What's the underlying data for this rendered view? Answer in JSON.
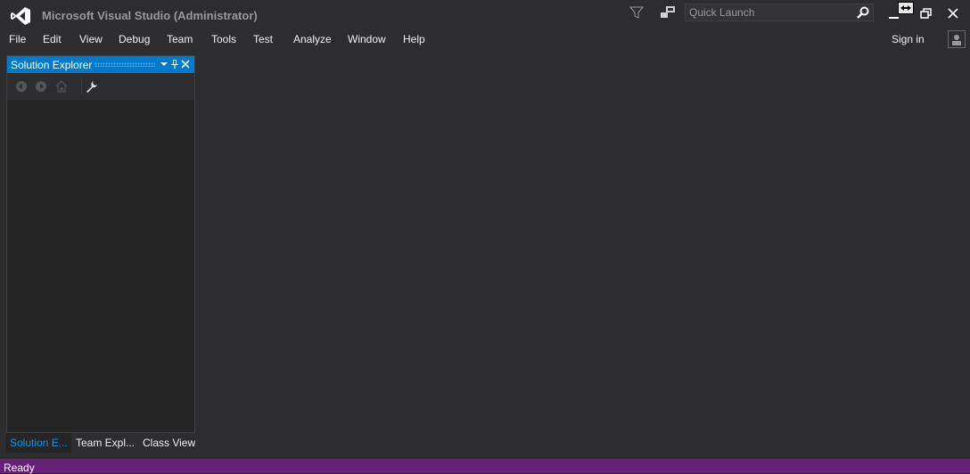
{
  "window": {
    "title": "Microsoft Visual Studio (Administrator)"
  },
  "search": {
    "placeholder": "Quick Launch"
  },
  "menu": {
    "items": [
      {
        "label": "File"
      },
      {
        "label": "Edit"
      },
      {
        "label": "View"
      },
      {
        "label": "Debug"
      },
      {
        "label": "Team"
      },
      {
        "label": "Tools"
      },
      {
        "label": "Test"
      },
      {
        "label": "Analyze"
      },
      {
        "label": "Window"
      },
      {
        "label": "Help"
      }
    ]
  },
  "account": {
    "signin_label": "Sign in"
  },
  "solution_explorer": {
    "title": "Solution Explorer",
    "icons": [
      "back-icon",
      "forward-icon",
      "home-icon",
      "wrench-icon"
    ]
  },
  "bottom_tabs": [
    {
      "label": "Solution E..."
    },
    {
      "label": "Team Expl..."
    },
    {
      "label": "Class View"
    }
  ],
  "status": {
    "text": "Ready"
  },
  "colors": {
    "background": "#2d2d30",
    "accent": "#007acc",
    "statusbar": "#68217a",
    "panel": "#252526",
    "active_tab_text": "#0e97e8",
    "logo": "#ffffff"
  }
}
